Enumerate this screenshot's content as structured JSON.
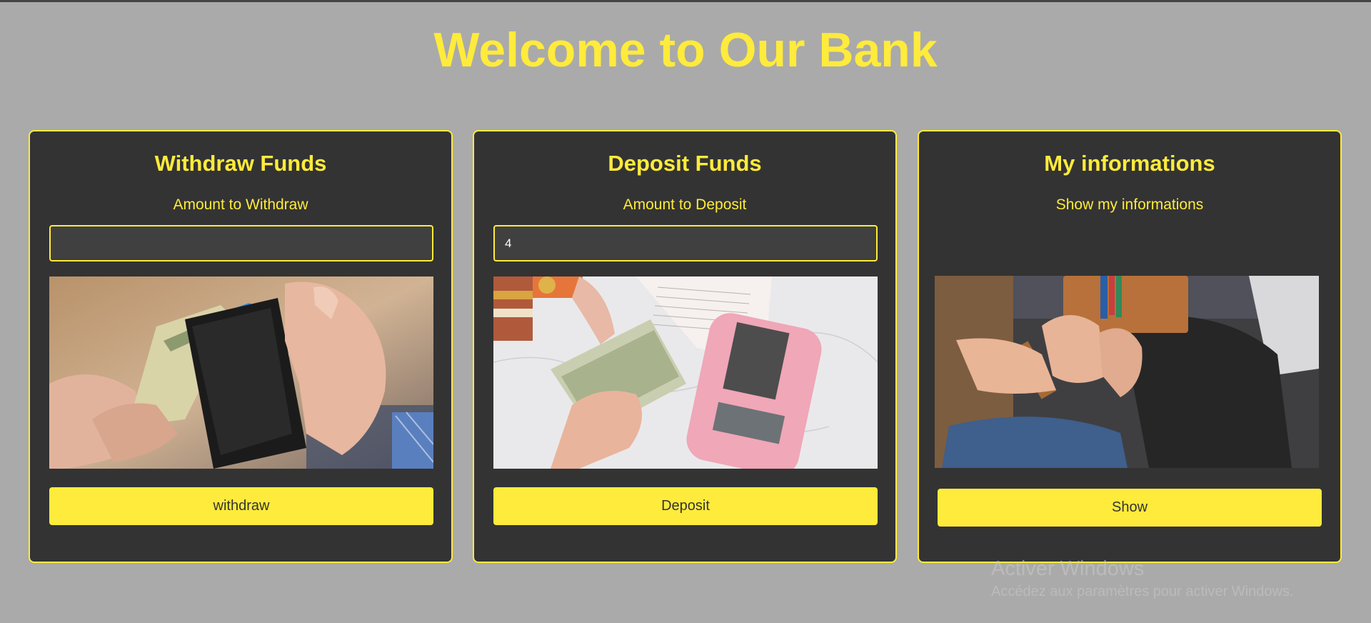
{
  "page": {
    "title": "Welcome to Our Bank"
  },
  "cards": [
    {
      "title": "Withdraw Funds",
      "subtitle": "Amount to Withdraw",
      "input_value": "",
      "image": "hands pulling cash from a black card wallet",
      "button_label": "withdraw"
    },
    {
      "title": "Deposit Funds",
      "subtitle": "Amount to Deposit",
      "input_value": "4",
      "image": "hands exchanging dollar bills next to a pink calculator",
      "button_label": "Deposit"
    },
    {
      "title": "My informations",
      "subtitle": "Show my informations",
      "image": "person opening a brown leather wallet",
      "button_label": "Show"
    }
  ],
  "watermark": {
    "title": "Activer Windows",
    "subtitle": "Accédez aux paramètres pour activer Windows."
  },
  "colors": {
    "background": "#aaaaaa",
    "card": "#333333",
    "accent": "#ffeb3b",
    "input": "#404040"
  }
}
